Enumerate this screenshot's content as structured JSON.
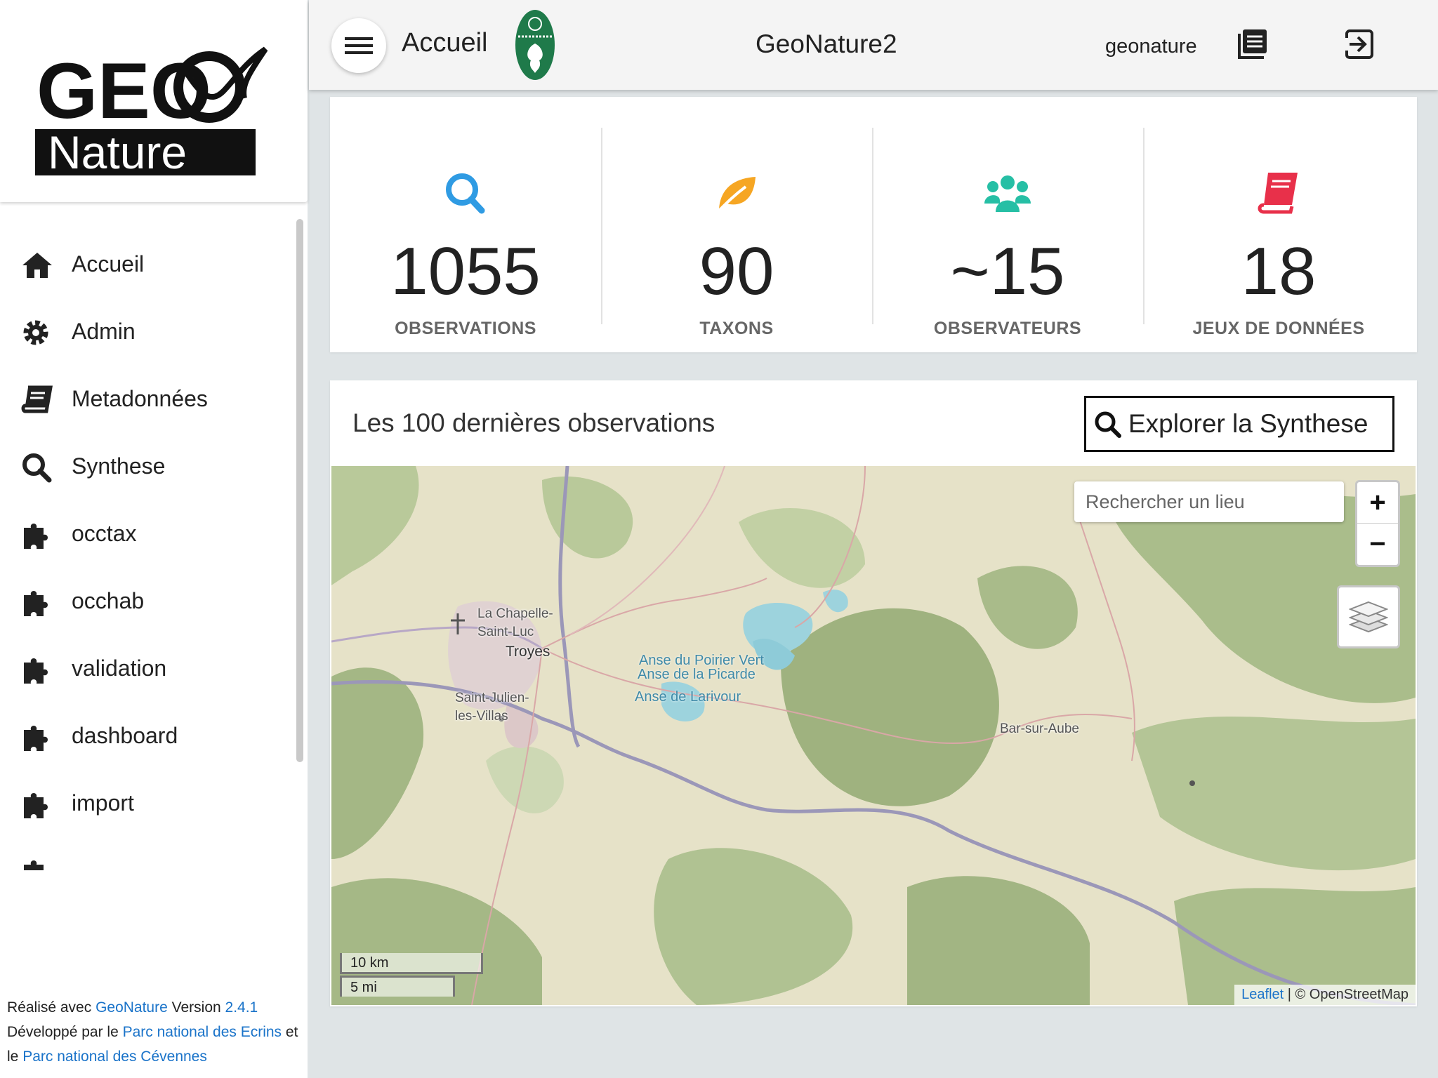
{
  "header": {
    "page_title": "Accueil",
    "app_title": "GeoNature2",
    "username": "geonature"
  },
  "logo": {
    "line1": "GEO",
    "line2": "Nature"
  },
  "sidebar": {
    "items": [
      {
        "label": "Accueil",
        "icon": "home-icon"
      },
      {
        "label": "Admin",
        "icon": "gear-icon"
      },
      {
        "label": "Metadonnées",
        "icon": "book-icon"
      },
      {
        "label": "Synthese",
        "icon": "search-icon"
      },
      {
        "label": "occtax",
        "icon": "puzzle-icon"
      },
      {
        "label": "occhab",
        "icon": "puzzle-icon"
      },
      {
        "label": "validation",
        "icon": "puzzle-icon"
      },
      {
        "label": "dashboard",
        "icon": "puzzle-icon"
      },
      {
        "label": "import",
        "icon": "puzzle-icon"
      }
    ]
  },
  "footer": {
    "made_with": "Réalisé avec ",
    "geonature_link": "GeoNature",
    "version_label": " Version ",
    "version": "2.4.1",
    "developed_by": "Développé par le ",
    "ecrins_link": "Parc national des Ecrins",
    "and": " et le ",
    "cevennes_link": "Parc national des Cévennes"
  },
  "stats": [
    {
      "value": "1055",
      "label": "OBSERVATIONS",
      "icon": "search-icon",
      "color": "#2f9be3"
    },
    {
      "value": "90",
      "label": "TAXONS",
      "icon": "leaf-icon",
      "color": "#f6a623"
    },
    {
      "value": "~15",
      "label": "OBSERVATEURS",
      "icon": "users-icon",
      "color": "#26bfa5"
    },
    {
      "value": "18",
      "label": "JEUX DE DONNÉES",
      "icon": "book-icon",
      "color": "#e8304a"
    }
  ],
  "map_card": {
    "title": "Les 100 dernières observations",
    "explore_button": "Explorer la Synthese",
    "search_placeholder": "Rechercher un lieu",
    "zoom_in": "+",
    "zoom_out": "−",
    "scale_km": "10 km",
    "scale_mi": "5 mi",
    "attribution_leaflet": "Leaflet",
    "attribution_rest": " | © OpenStreetMap",
    "places": {
      "la_chapelle": "La Chapelle-\nSaint-Luc",
      "troyes": "Troyes",
      "saint_julien": "Saint-Julien-\nles-Villas",
      "anse_poirier": "Anse du Poirier Vert",
      "anse_picarde": "Anse de la Picarde",
      "anse_larivour": "Anse de Larivour",
      "bar_sur_aube": "Bar-sur-Aube"
    }
  }
}
